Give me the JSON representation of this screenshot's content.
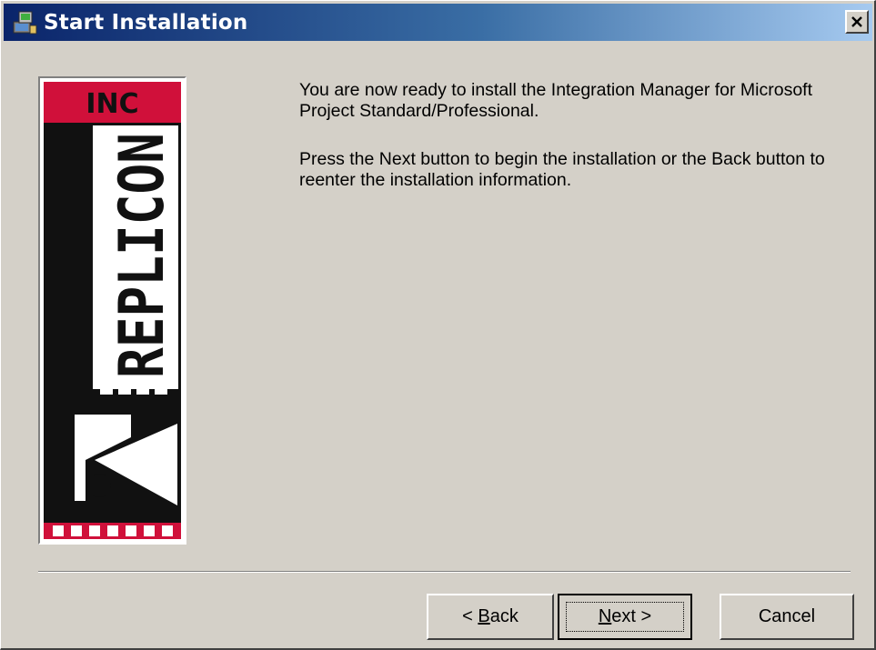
{
  "window": {
    "title": "Start Installation",
    "close_glyph": "×"
  },
  "logo": {
    "top_text": "INC",
    "vertical_text": "REPLICON",
    "letter": "R"
  },
  "message": {
    "paragraph1": "You are now ready to install the Integration Manager for Microsoft Project Standard/Professional.",
    "paragraph2": "Press the Next button to begin the installation or the Back button to reenter the installation information."
  },
  "buttons": {
    "back_prefix": "< ",
    "back_mnemonic": "B",
    "back_rest": "ack",
    "next_mnemonic": "N",
    "next_rest": "ext >",
    "cancel": "Cancel"
  },
  "colors": {
    "title_gradient_start": "#0a246a",
    "title_gradient_end": "#a6caf0",
    "logo_red": "#d0103a",
    "logo_black": "#111111",
    "dialog_face": "#d4d0c8"
  }
}
